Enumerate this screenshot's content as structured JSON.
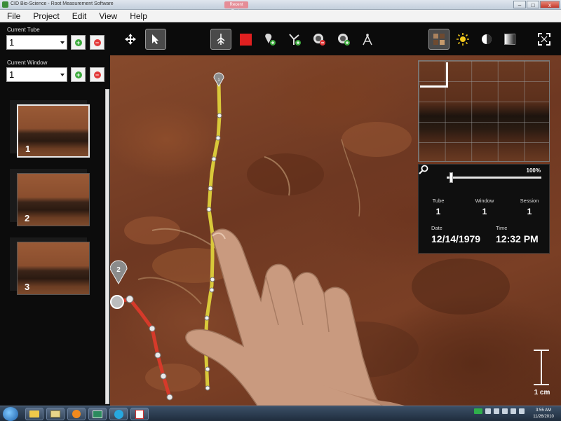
{
  "window": {
    "title": "CID Bio-Science - Root Measurement Software",
    "badge": "Recent Tools",
    "controls": [
      "–",
      "□",
      "x"
    ]
  },
  "menu": [
    "File",
    "Project",
    "Edit",
    "View",
    "Help"
  ],
  "left_panel": {
    "tube_label": "Current Tube",
    "tube_value": "1",
    "window_label": "Current Window",
    "window_value": "1",
    "add_symbol": "+",
    "remove_symbol": "−",
    "thumbnails": [
      {
        "label": "1",
        "selected": true
      },
      {
        "label": "2",
        "selected": false
      },
      {
        "label": "3",
        "selected": false
      }
    ]
  },
  "toolbar": {
    "tools": [
      "pan-icon",
      "select-pointer-icon",
      "root-tool-icon",
      "stop-square-icon",
      "add-tip-icon",
      "add-branch-icon",
      "remove-node-icon",
      "add-node-icon",
      "measure-compass-icon",
      "thumbnail-grid-icon",
      "brightness-icon",
      "contrast-icon",
      "gradient-icon",
      "fit-screen-icon"
    ],
    "accent_red": "#e02020"
  },
  "root_markers": {
    "marker1": "1",
    "marker2": "2",
    "yellow_color": "#d9c93a",
    "red_color": "#d63a2a"
  },
  "info_panel": {
    "zoom_percent": "100%",
    "zoom_level": 0.03,
    "tube_label": "Tube",
    "tube_value": "1",
    "window_label": "Window",
    "window_value": "1",
    "session_label": "Session",
    "session_value": "1",
    "date_label": "Date",
    "date_value": "12/14/1979",
    "time_label": "Time",
    "time_value": "12:32 PM"
  },
  "scale": {
    "label": "1 cm"
  },
  "taskbar": {
    "items": [
      "folder-icon",
      "media-icon",
      "app-icon",
      "skype-icon",
      "pdf-icon"
    ],
    "clock_time": "3:55 AM",
    "clock_date": "11/26/2010"
  }
}
